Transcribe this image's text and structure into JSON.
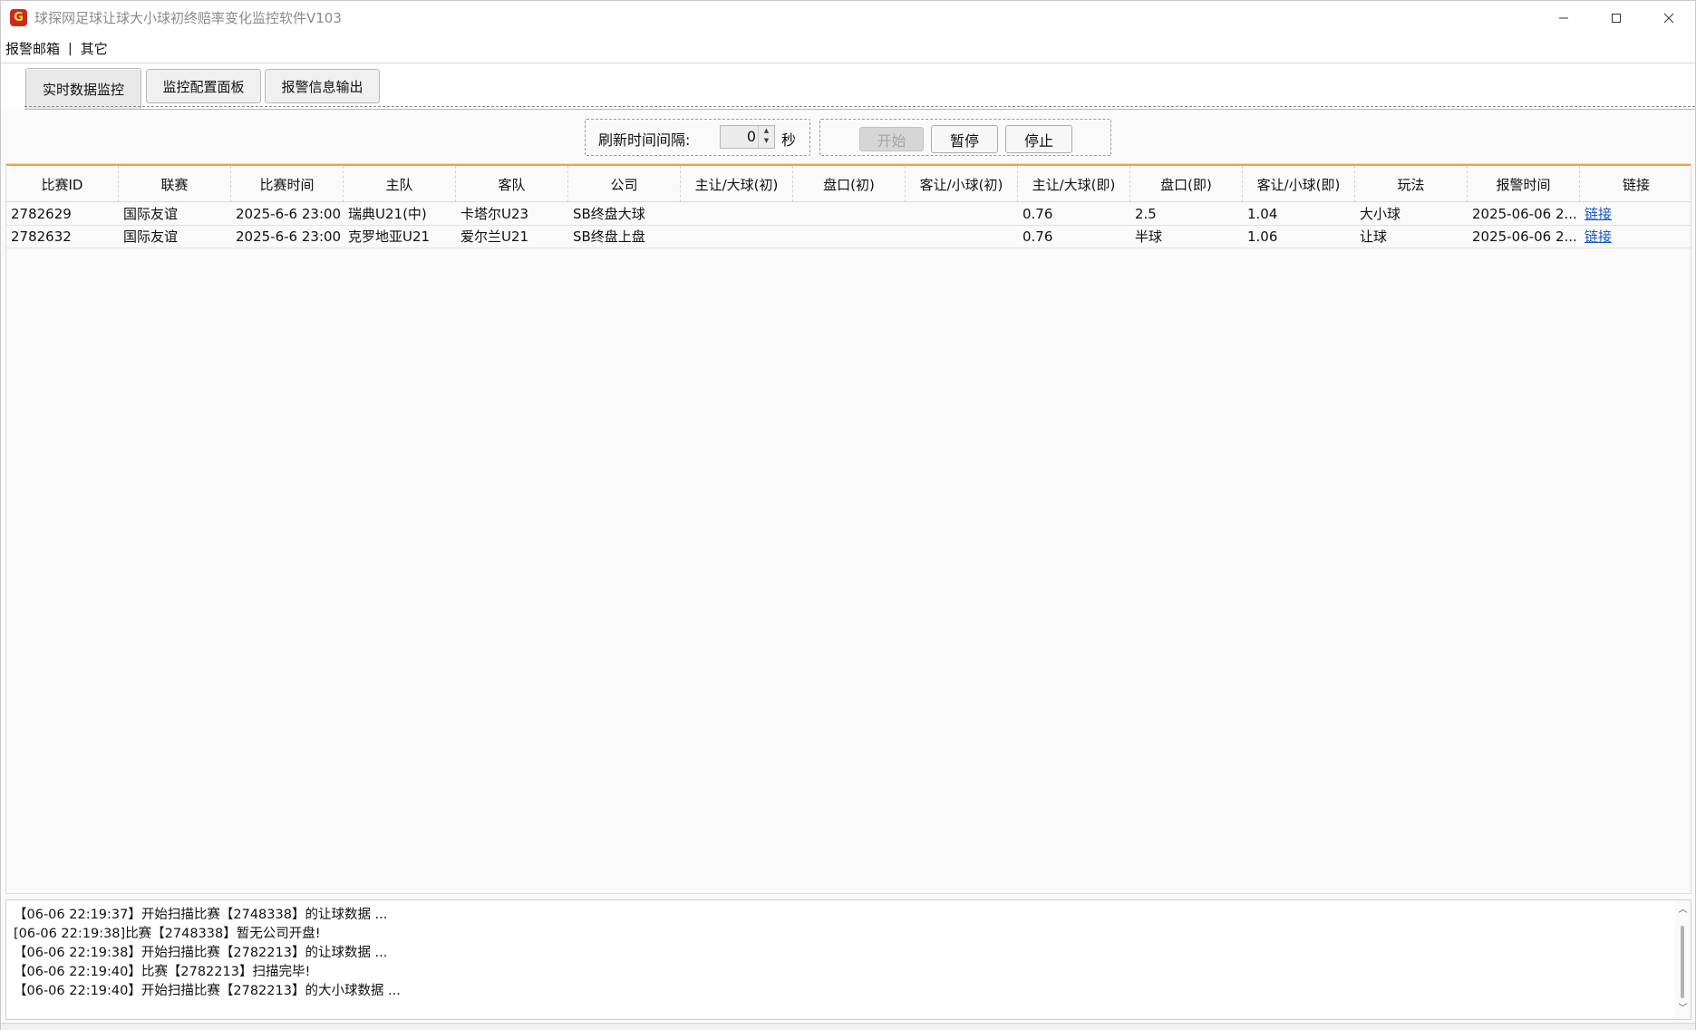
{
  "window": {
    "title": "球探网足球让球大小球初终赔率变化监控软件V103",
    "icon": "app-logo-icon"
  },
  "menu": {
    "items": [
      "报警邮箱",
      "其它"
    ],
    "separator": "|"
  },
  "tabs": [
    {
      "label": "实时数据监控",
      "active": true
    },
    {
      "label": "监控配置面板",
      "active": false
    },
    {
      "label": "报警信息输出",
      "active": false
    }
  ],
  "controls": {
    "interval_label": "刷新时间间隔:",
    "interval_value": "0",
    "interval_unit": "秒",
    "start_label": "开始",
    "pause_label": "暂停",
    "stop_label": "停止"
  },
  "table": {
    "columns": [
      "比赛ID",
      "联赛",
      "比赛时间",
      "主队",
      "客队",
      "公司",
      "主让/大球(初)",
      "盘口(初)",
      "客让/小球(初)",
      "主让/大球(即)",
      "盘口(即)",
      "客让/小球(即)",
      "玩法",
      "报警时间",
      "链接"
    ],
    "rows": [
      [
        "2782629",
        "国际友谊",
        "2025-6-6 23:00",
        "瑞典U21(中)",
        "卡塔尔U23",
        "SB终盘大球",
        "",
        "",
        "",
        "0.76",
        "2.5",
        "1.04",
        "大小球",
        "2025-06-06 2...",
        "链接"
      ],
      [
        "2782632",
        "国际友谊",
        "2025-6-6 23:00",
        "克罗地亚U21",
        "爱尔兰U21",
        "SB终盘上盘",
        "",
        "",
        "",
        "0.76",
        "半球",
        "1.06",
        "让球",
        "2025-06-06 2...",
        "链接"
      ]
    ]
  },
  "log": {
    "lines": [
      "【06-06 22:19:37】开始扫描比赛【2748338】的让球数据 ...",
      "[06-06 22:19:38]比赛【2748338】暂无公司开盘!",
      "【06-06 22:19:38】开始扫描比赛【2782213】的让球数据 ...",
      "【06-06 22:19:40】比赛【2782213】扫描完毕!",
      "【06-06 22:19:40】开始扫描比赛【2782213】的大小球数据 ..."
    ]
  },
  "colors": {
    "accent_orange": "#f0a53a",
    "link_blue": "#1a56c7",
    "disabled_gray": "#a4a4a4"
  }
}
